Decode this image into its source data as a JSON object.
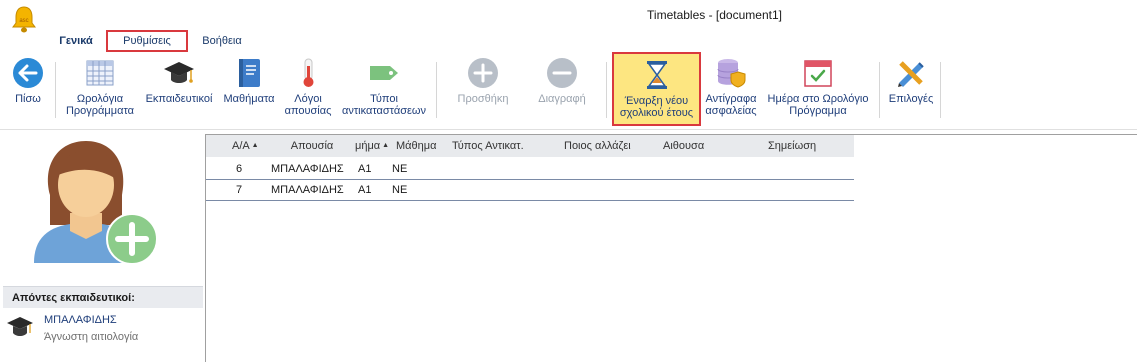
{
  "window": {
    "title": "Timetables - [document1]"
  },
  "tabs": [
    {
      "label": "Γενικά"
    },
    {
      "label": "Ρυθμίσεις"
    },
    {
      "label": "Βοήθεια"
    }
  ],
  "ribbon": {
    "back": "Πίσω",
    "timetables_1": "Ωρολόγια",
    "timetables_2": "Προγράμματα",
    "teachers": "Εκπαιδευτικοί",
    "lessons": "Μαθήματα",
    "absence_reasons_1": "Λόγοι",
    "absence_reasons_2": "απουσίας",
    "sub_types_1": "Τύποι",
    "sub_types_2": "αντικαταστάσεων",
    "add": "Προσθήκη",
    "delete": "Διαγραφή",
    "new_year_1": "Έναρξη νέου",
    "new_year_2": "σχολικού έτους",
    "backups_1": "Αντίγραφα",
    "backups_2": "ασφαλείας",
    "day_in_timetable_1": "Ημέρα στο Ωρολόγιο",
    "day_in_timetable_2": "Πρόγραμμα",
    "options": "Επιλογές"
  },
  "left_panel": {
    "absent_header": "Απόντες εκπαιδευτικοί:",
    "absent_teachers": [
      {
        "name": "ΜΠΑΛΑΦΙΔΗΣ",
        "reason": "Άγνωστη αιτιολογία"
      }
    ]
  },
  "grid": {
    "columns": [
      "Α/Α",
      "Απουσία",
      "μήμα",
      "Μάθημα",
      "Τύπος Αντικατ.",
      "Ποιος αλλάζει",
      "Αιθουσα",
      "Σημείωση"
    ],
    "rows": [
      [
        "6",
        "ΜΠΑΛΑΦΙΔΗΣ",
        "Α1",
        "ΝΕ",
        "",
        "",
        "",
        ""
      ],
      [
        "7",
        "ΜΠΑΛΑΦΙΔΗΣ",
        "Α1",
        "ΝΕ",
        "",
        "",
        "",
        ""
      ]
    ]
  },
  "colors": {
    "highlight_border": "#d9393e",
    "highlight_fill": "#fde681",
    "link_text": "#1f3e7a"
  }
}
